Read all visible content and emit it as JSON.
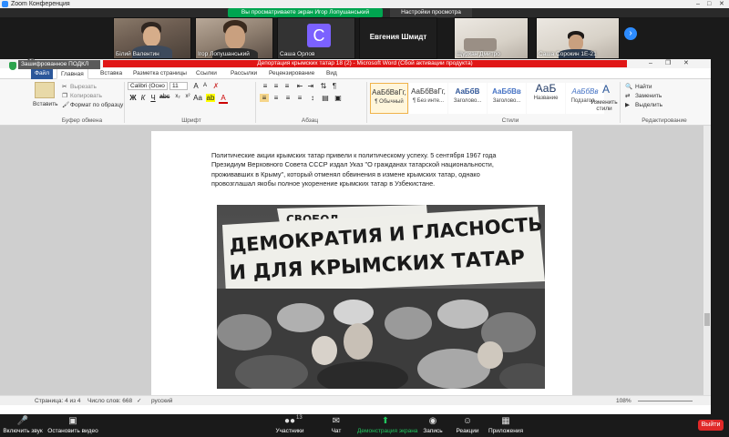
{
  "zoom": {
    "window_title": "Zoom Конференция",
    "share_banner": "Вы просматриваете экран Игор Лопушанський",
    "view_options": "Настройки просмотра",
    "participants": [
      "Білий Валентин",
      "Ігор Лопушанський",
      "Саша Орлов",
      "Евгения Шмидт",
      "Щурхан Дмитро",
      "Саша Сорокин 1Е-21"
    ],
    "avatar_letter": "C",
    "participant_count": "13",
    "toolbar": {
      "mute": "Включить звук",
      "video": "Остановить видео",
      "participants": "Участники",
      "chat": "Чат",
      "share": "Демонстрация экрана",
      "record": "Запись",
      "reactions": "Реакции",
      "apps": "Приложения",
      "end": "Выйти"
    },
    "tooltip": "Зашифрованное ПОДКЛ",
    "accent": "#2d8cff",
    "share_green": "#00a550",
    "end_red": "#e02828"
  },
  "word": {
    "title": "Депортация крымских татар 18 (2) - Microsoft Word (Сбой активации продукта)",
    "tabs": [
      "Файл",
      "Главная",
      "Вставка",
      "Разметка страницы",
      "Ссылки",
      "Рассылки",
      "Рецензирование",
      "Вид"
    ],
    "clipboard": {
      "paste": "Вставить",
      "cut": "Вырезать",
      "copy": "Копировать",
      "format_painter": "Формат по образцу",
      "label": "Буфер обмена"
    },
    "font": {
      "name": "Calibri (Осно",
      "size": "11",
      "label": "Шрифт"
    },
    "paragraph_label": "Абзац",
    "styles": [
      {
        "sample": "АаБбВвГг,",
        "name": "¶ Обычный"
      },
      {
        "sample": "АаБбВвГг,",
        "name": "¶ Без инте..."
      },
      {
        "sample": "АаБбВ",
        "name": "Заголово..."
      },
      {
        "sample": "АаБбВв",
        "name": "Заголово..."
      },
      {
        "sample": "АаБ",
        "name": "Название"
      },
      {
        "sample": "АаБбВв",
        "name": "Подзагол..."
      }
    ],
    "change_styles": "Изменить стили",
    "styles_label": "Стили",
    "editing": {
      "find": "Найти",
      "replace": "Заменить",
      "select": "Выделить",
      "label": "Редактирование"
    },
    "body_text": "Политические акции крымских татар привели к политическому успеху. 5 сентября 1967 года Президиум Верховного Совета СССР издал Указ \"О гражданах татарской национальности, проживавших в Крыму\", который отменял обвинения в измене крымских татар, однако провозглашал якобы полное укоренение крымских татар в Узбекистане.",
    "photo_banner": {
      "line1": "ДЕМОКРАТИЯ И ГЛАСНОСТЬ",
      "line2": "И ДЛЯ КРЫМСКИХ ТАТАР",
      "top_sign": "СВОБОД"
    },
    "status": {
      "page": "Страница: 4 из 4",
      "words": "Число слов: 668",
      "lang": "русский",
      "zoom": "108%"
    }
  }
}
